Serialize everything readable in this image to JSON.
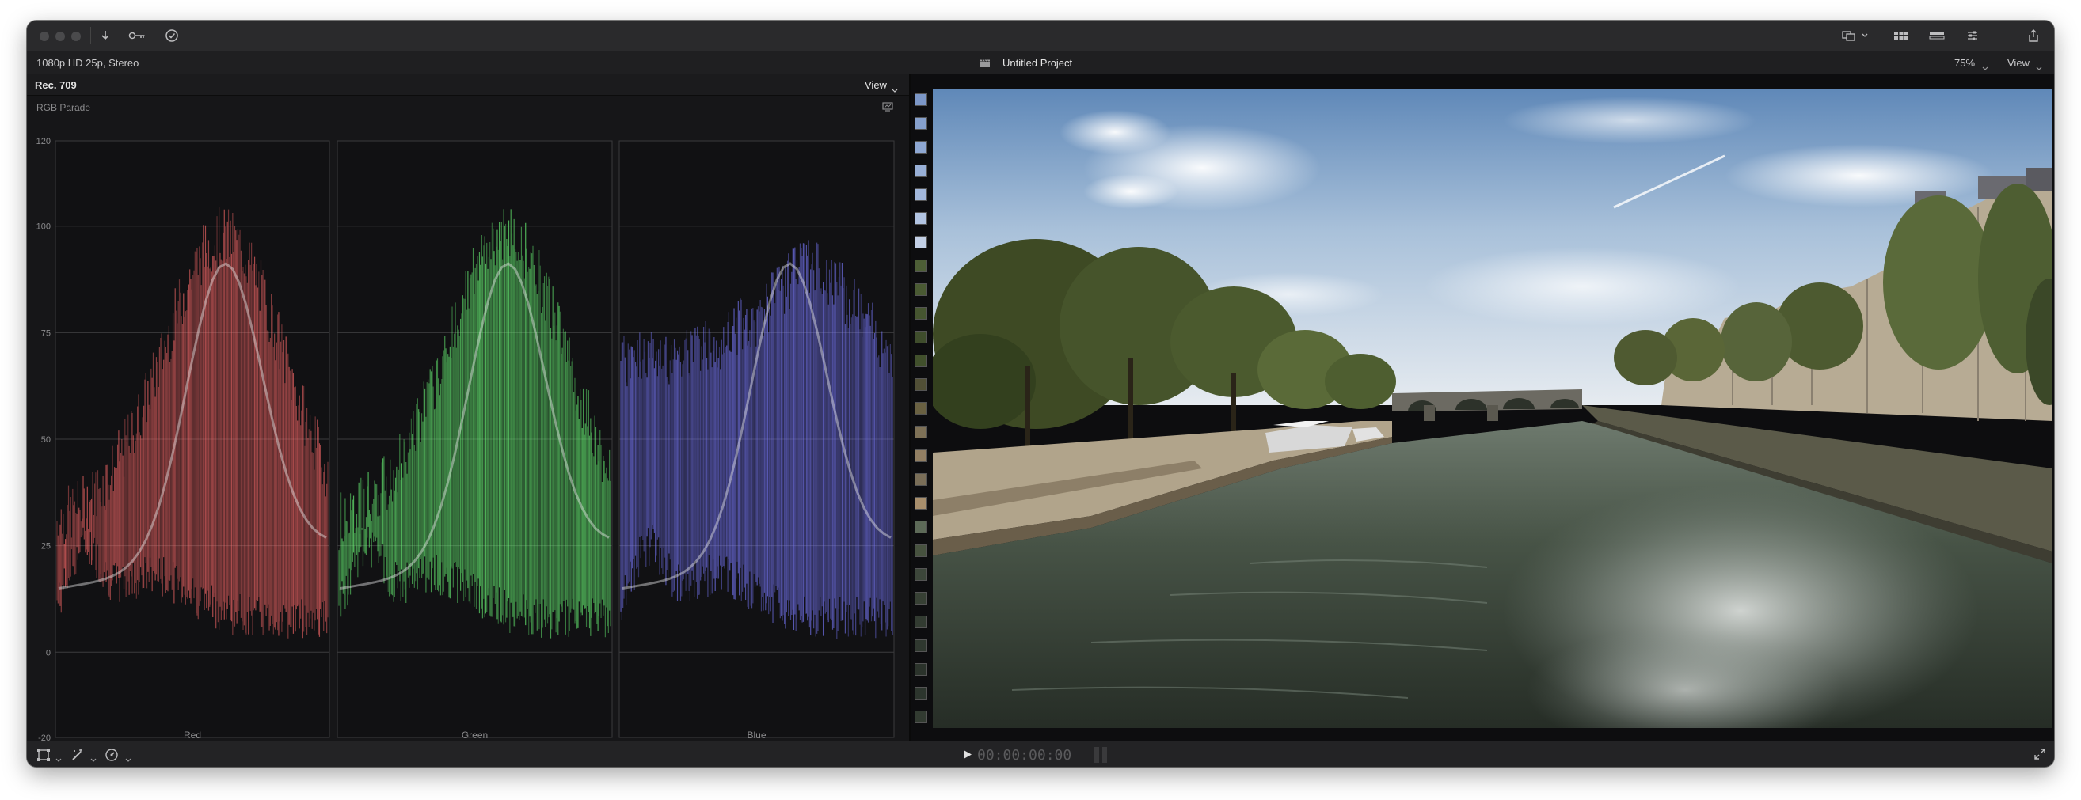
{
  "project": {
    "format": "1080p HD 25p, Stereo",
    "name": "Untitled Project",
    "zoom": "75%",
    "view_label": "View"
  },
  "scope": {
    "color_space": "Rec. 709",
    "view_label": "View",
    "type": "RGB Parade",
    "scale": [
      "120",
      "100",
      "75",
      "50",
      "25",
      "0",
      "-20"
    ],
    "channels": [
      {
        "name": "Red",
        "color": "#ff6b6b"
      },
      {
        "name": "Green",
        "color": "#6dff7a"
      },
      {
        "name": "Blue",
        "color": "#7a7aff"
      }
    ]
  },
  "playback": {
    "timecode": "00:00:00:00"
  },
  "icons": {
    "titlebar": [
      "import-icon",
      "keyword-icon",
      "background-tasks-icon",
      "inspector-toggle-icon",
      "browser-layout-icon",
      "timeline-layout-icon",
      "adjust-icon",
      "share-icon"
    ],
    "bottombar": [
      "transform-icon",
      "enhance-icon",
      "retime-icon",
      "play-icon",
      "fullscreen-icon"
    ]
  },
  "colors": {
    "window_bg": "#1b1b1d",
    "titlebar_bg": "#2a2a2c",
    "scope_bg": "#161618",
    "text": "#c9c9cb"
  }
}
